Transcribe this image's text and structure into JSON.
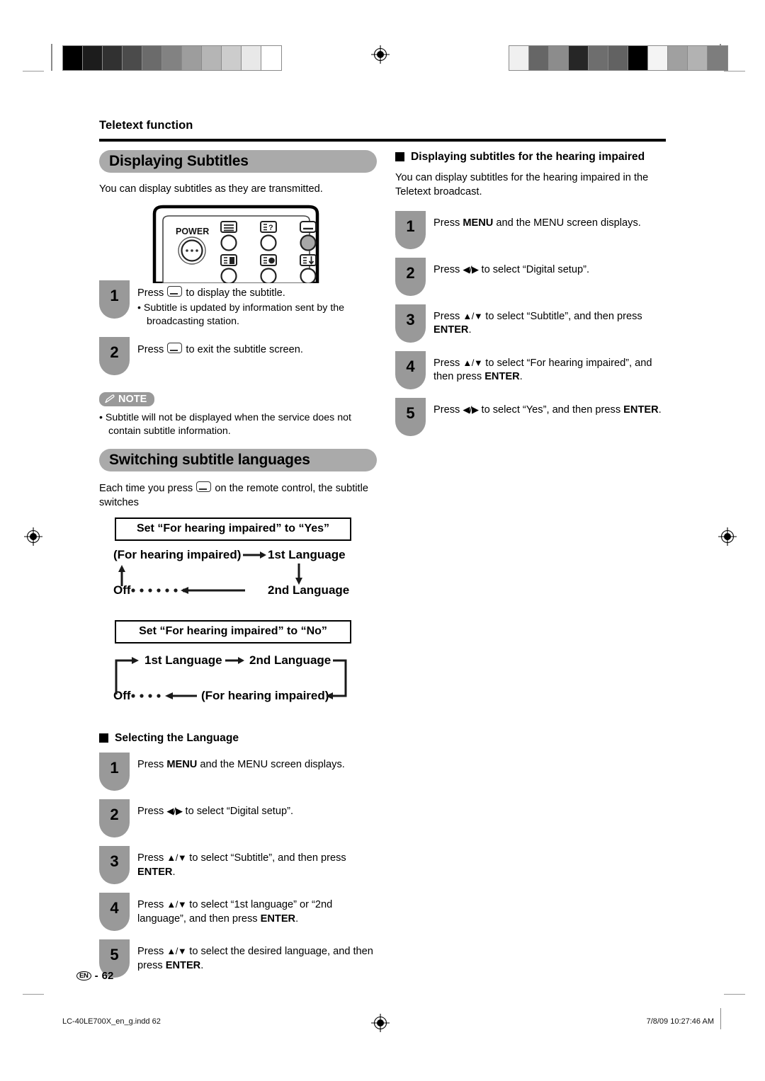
{
  "document": {
    "running_head": "Teletext function",
    "page_label": "62",
    "language_code": "EN",
    "page_separator": "-"
  },
  "footer": {
    "file_name": "LC-40LE700X_en_g.indd   62",
    "timestamp": "7/8/09   10:27:46 AM"
  },
  "calibration": {
    "left_strip": [
      "#000000",
      "#1c1c1c",
      "#313131",
      "#4b4b4b",
      "#6b6b6b",
      "#828282",
      "#9d9d9d",
      "#b5b5b5",
      "#cccccc",
      "#e8e8e8",
      "#ffffff"
    ],
    "right_strip": [
      "#f0f0f0",
      "#666666",
      "#8c8c8c",
      "#262626",
      "#6e6e6e",
      "#626262",
      "#000000",
      "#f4f4f4",
      "#a0a0a0",
      "#b2b2b2",
      "#7d7d7d"
    ]
  },
  "left_column": {
    "section1": {
      "title": "Displaying Subtitles",
      "intro": "You can display subtitles as they are transmitted.",
      "remote_labels": {
        "power": "POWER"
      },
      "steps": [
        {
          "num": "1",
          "text_before": "Press ",
          "text_after": " to display the subtitle.",
          "sub": "• Subtitle is updated by information sent by the broadcasting station."
        },
        {
          "num": "2",
          "text_before": "Press ",
          "text_after": " to exit the subtitle screen.",
          "sub": ""
        }
      ],
      "note_label": "NOTE",
      "notes": [
        "• Subtitle will not be displayed when the service does not contain subtitle information."
      ]
    },
    "section2": {
      "title": "Switching subtitle languages",
      "intro_before": "Each time you press ",
      "intro_after": " on the remote control, the subtitle switches",
      "flow1": {
        "header": "Set “For hearing impaired” to “Yes”",
        "node_a": "(For hearing impaired)",
        "node_b": "1st Language",
        "node_c": "2nd Language",
        "node_d": "Off"
      },
      "flow2": {
        "header": "Set “For hearing impaired” to “No”",
        "node_a": "1st Language",
        "node_b": "2nd Language",
        "node_c": "(For hearing impaired)",
        "node_d": "Off"
      }
    },
    "section3": {
      "title": "Selecting the Language",
      "steps": [
        {
          "num": "1",
          "html": "Press <b>MENU</b> and the MENU screen displays."
        },
        {
          "num": "2",
          "html": "Press <ar>◀/▶</ar> to select “Digital setup”."
        },
        {
          "num": "3",
          "html": "Press <ar>▲/▼</ar> to select “Subtitle”, and then press <b>ENTER</b>."
        },
        {
          "num": "4",
          "html": "Press <ar>▲/▼</ar> to select “1st language” or “2nd language”, and then press <b>ENTER</b>."
        },
        {
          "num": "5",
          "html": "Press <ar>▲/▼</ar> to select the desired language, and then press <b>ENTER</b>."
        }
      ]
    }
  },
  "right_column": {
    "section1": {
      "title": "Displaying subtitles for the hearing impaired",
      "intro": "You can display subtitles for the hearing impaired in the Teletext broadcast.",
      "steps": [
        {
          "num": "1",
          "html": "Press <b>MENU</b> and the MENU screen displays."
        },
        {
          "num": "2",
          "html": "Press <ar>◀/▶</ar> to select “Digital setup”."
        },
        {
          "num": "3",
          "html": "Press <ar>▲/▼</ar> to select “Subtitle”, and then press <b>ENTER</b>."
        },
        {
          "num": "4",
          "html": "Press <ar>▲/▼</ar> to select “For hearing impaired”, and then press <b>ENTER</b>."
        },
        {
          "num": "5",
          "html": "Press <ar>◀/▶</ar> to select “Yes”, and then press <b>ENTER</b>."
        }
      ]
    }
  },
  "colors": {
    "pill_gray": "#aaaaaa",
    "badge_gray": "#999999",
    "rule_black": "#000000"
  }
}
